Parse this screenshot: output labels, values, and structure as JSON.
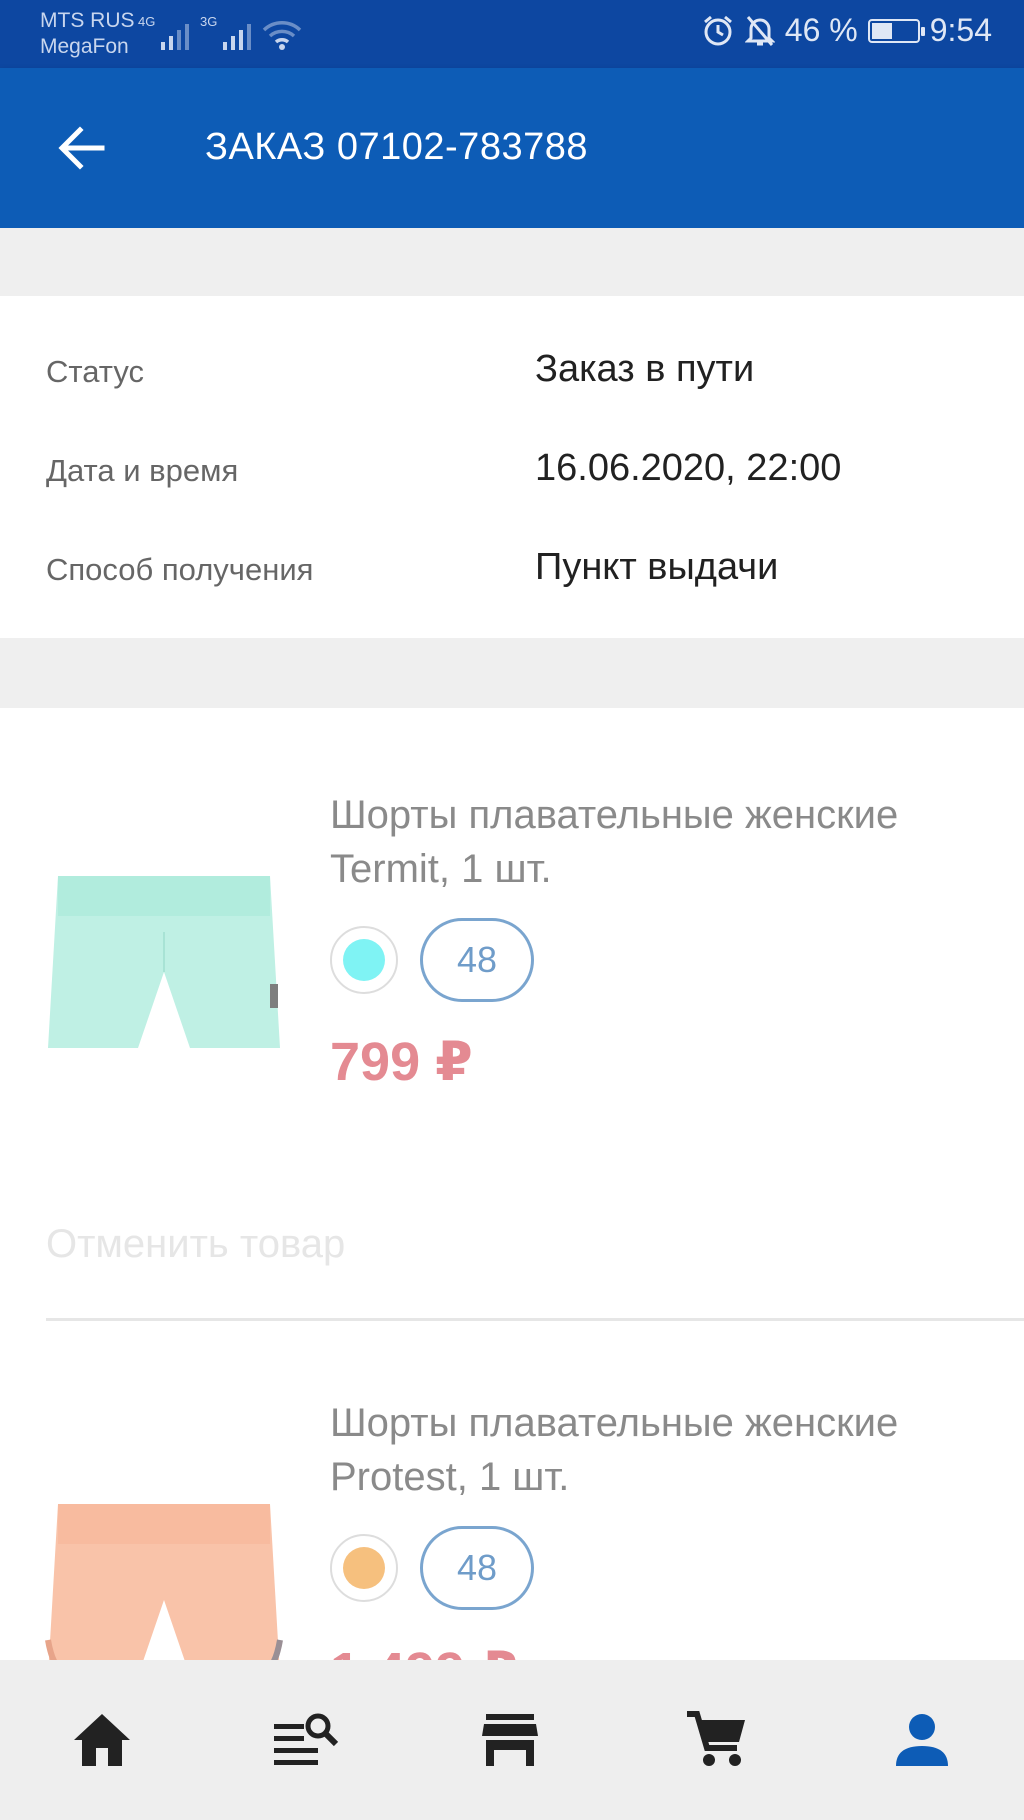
{
  "status_bar": {
    "carrier1": "MTS RUS",
    "carrier2": "MegaFon",
    "net1": "4G",
    "net2": "3G",
    "battery_text": "46 %",
    "battery_level": 0.46,
    "time": "9:54",
    "icons": [
      "signal-icon",
      "wifi-icon",
      "alarm-icon",
      "mute-icon",
      "battery-icon"
    ]
  },
  "header": {
    "title": "ЗАКАЗ 07102-783788",
    "back_icon": "arrow-back-icon"
  },
  "order_info": [
    {
      "label": "Статус",
      "value": "Заказ в пути"
    },
    {
      "label": "Дата и время",
      "value": "16.06.2020, 22:00"
    },
    {
      "label": "Способ получения",
      "value": "Пункт выдачи"
    }
  ],
  "items": [
    {
      "name": "Шорты плавательные женские Termit, 1 шт.",
      "color": "#7ff3f4",
      "size": "48",
      "price": "799 ₽",
      "cancel_label": "Отменить товар",
      "image_color": "#bff0e4"
    },
    {
      "name": "Шорты плавательные женские Protest, 1 шт.",
      "color": "#f6c07e",
      "size": "48",
      "price": "1 499 ₽",
      "image_color": "#f9c3a9"
    }
  ],
  "bottom_nav": [
    {
      "name": "home-icon",
      "active": false
    },
    {
      "name": "catalog-search-icon",
      "active": false
    },
    {
      "name": "store-icon",
      "active": false
    },
    {
      "name": "cart-icon",
      "active": false
    },
    {
      "name": "profile-icon",
      "active": true
    }
  ],
  "colors": {
    "primary": "#0d5cb6",
    "status_bar": "#0d47a1",
    "price": "#e48a92",
    "nav_active": "#0d5cb6",
    "nav_inactive": "#222222"
  }
}
